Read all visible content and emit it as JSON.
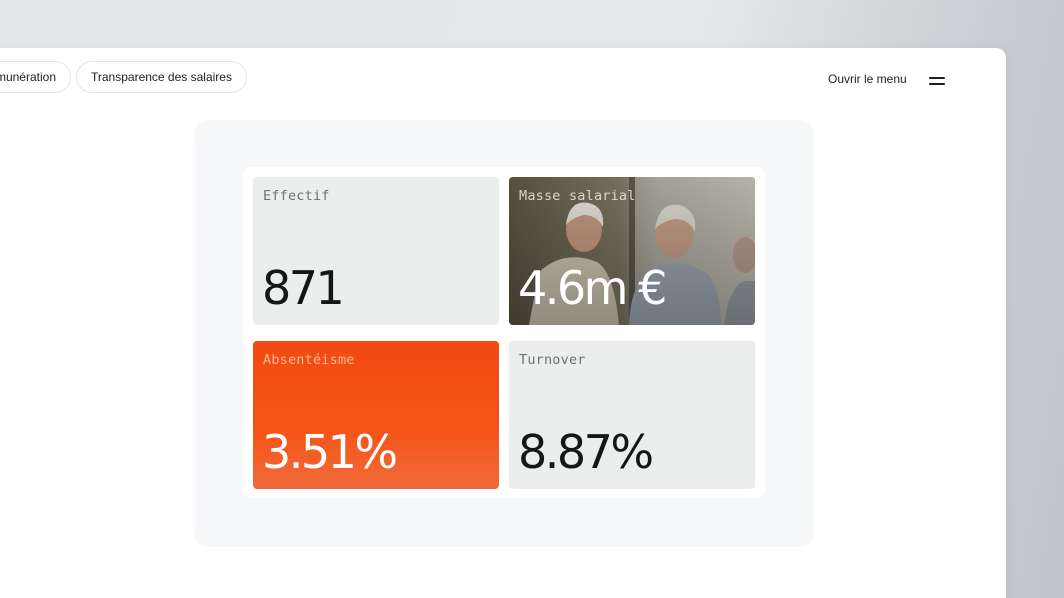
{
  "nav": {
    "chips": [
      {
        "label": "Rémunération"
      },
      {
        "label": "Transparence des salaires"
      }
    ],
    "menu_label": "Ouvrir le menu",
    "menu_icon": "hamburger-icon"
  },
  "stats": {
    "cards": [
      {
        "label": "Effectif",
        "value": "871"
      },
      {
        "label": "Masse salarial",
        "value": "4.6m €"
      },
      {
        "label": "Absentéisme",
        "value": "3.51%"
      },
      {
        "label": "Turnover",
        "value": "8.87%"
      }
    ]
  },
  "colors": {
    "accent_orange": "#f24a12",
    "card_gray": "#eceeed",
    "panel_bg": "#f6f7f8",
    "text_dark": "#141719"
  }
}
